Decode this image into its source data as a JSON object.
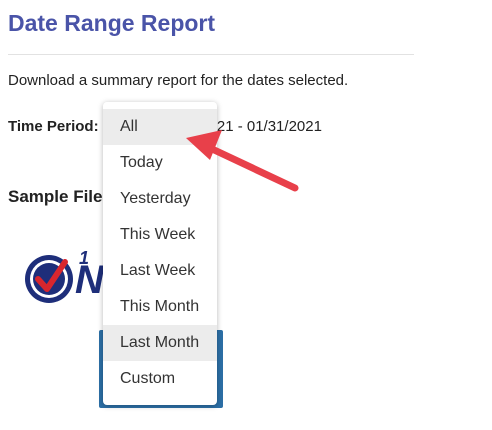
{
  "page": {
    "title": "Date Range Report",
    "description": "Download a summary report for the dates selected.",
    "time_period_label": "Time Period:",
    "date_range_visible": "/2021 - 01/31/2021",
    "sample_file_label": "Sample File"
  },
  "logo": {
    "number_text": "1",
    "letter_text": "N"
  },
  "dropdown": {
    "options": [
      "All",
      "Today",
      "Yesterday",
      "This Week",
      "Last Week",
      "This Month",
      "Last Month",
      "Custom"
    ],
    "highlighted": [
      "All",
      "Last Month"
    ]
  },
  "colors": {
    "title": "#4a54a8",
    "arrow": "#e8404a",
    "sample_box": "#2c6fa6",
    "logo_navy": "#1e2e7a",
    "logo_check": "#d8262e"
  },
  "icons": {
    "arrow": "red-pointer-arrow-icon",
    "logo_check": "check-circle-icon"
  }
}
